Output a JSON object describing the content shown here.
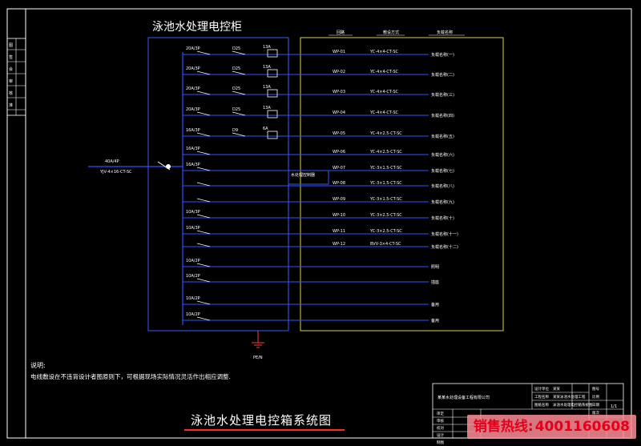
{
  "cabinet_title": "泳池水处理电控柜",
  "diagram_title": "泳池水处理电控箱系统图",
  "notes": {
    "heading": "说明:",
    "body": "电线敷设在不违背设计者图原则下，可根据现场实际情况灵活作出相应调整."
  },
  "hotline": {
    "label": "销售热线:",
    "number": "4001160608"
  },
  "incoming": {
    "breaker": "40A/4P",
    "cable": "YJV-4×16-CT-SC"
  },
  "header": {
    "col1": "回路",
    "col2": "敷设方式",
    "col3": "负载名称"
  },
  "ground_label": "PE/N",
  "circuits": [
    {
      "breaker": "20A/3P",
      "contactor": "D25",
      "relay": "13A",
      "id": "WP-01",
      "cable": "YC-4×4-CT-SC",
      "load": "负载名称(一)"
    },
    {
      "breaker": "20A/3P",
      "contactor": "D25",
      "relay": "13A",
      "id": "WP-02",
      "cable": "YC-4×4-CT-SC",
      "load": "负载名称(二)"
    },
    {
      "breaker": "20A/3P",
      "contactor": "D25",
      "relay": "13A",
      "id": "WP-03",
      "cable": "YC-4×4-CT-SC",
      "load": "负载名称(三)"
    },
    {
      "breaker": "20A/3P",
      "contactor": "D25",
      "relay": "13A",
      "id": "WP-04",
      "cable": "YC-4×4-CT-SC",
      "load": "负载名称(四)"
    },
    {
      "breaker": "16A/3P",
      "contactor": "D9",
      "relay": "6A",
      "id": "WP-05",
      "cable": "YC-4×2.5-CT-SC",
      "load": "负载名称(五)"
    },
    {
      "breaker": "16A/3P",
      "contactor": "",
      "relay": "",
      "id": "WP-06",
      "cable": "YC-4×2.5-CT-SC",
      "load": "负载名称(六)"
    },
    {
      "breaker": "16A/3P",
      "contactor": "",
      "relay": "",
      "id": "WP-07",
      "cable": "YC-3×1.5-CT-SC",
      "load": "负载名称(七)"
    },
    {
      "breaker": "",
      "contactor": "",
      "relay": "",
      "id": "WP-08",
      "cable": "YC-3×1.5-CT-SC",
      "load": "负载名称(八)"
    },
    {
      "breaker": "",
      "contactor": "",
      "relay": "",
      "id": "WP-09",
      "cable": "YC-3×1.5-CT-SC",
      "load": "负载名称(九)"
    },
    {
      "breaker": "10A/3P",
      "contactor": "",
      "relay": "",
      "id": "WP-10",
      "cable": "YC-3×2.5-CT-SC",
      "load": "负载名称(十)"
    },
    {
      "breaker": "10A/3P",
      "contactor": "",
      "relay": "",
      "id": "WP-11",
      "cable": "YC-3×2.5-CT-SC",
      "load": "负载名称(十一)"
    },
    {
      "breaker": "",
      "contactor": "",
      "relay": "",
      "id": "WP-12",
      "cable": "BVV-3×4-CT-SC",
      "load": "负载名称(十二)"
    },
    {
      "breaker": "10A/2P",
      "contactor": "",
      "relay": "",
      "id": "",
      "cable": "",
      "load": "照明"
    },
    {
      "breaker": "10A/2P",
      "contactor": "",
      "relay": "",
      "id": "",
      "cable": "",
      "load": "插座"
    },
    {
      "breaker": "10A/2P",
      "contactor": "",
      "relay": "",
      "id": "",
      "cable": "",
      "load": "备用"
    },
    {
      "breaker": "10A/2P",
      "contactor": "",
      "relay": "",
      "id": "",
      "cable": "",
      "load": "备用"
    }
  ],
  "controller_label": "水处理控制器",
  "title_block": {
    "company": "某某水处理设备工程有限公司",
    "rows": [
      [
        "设计单位",
        "某某"
      ],
      [
        "工程名称",
        "某某泳池水处理工程"
      ],
      [
        "图纸名称",
        "泳池水处理电控箱系统图"
      ]
    ],
    "left_rows": [
      "审定",
      "审核",
      "校对",
      "设计",
      "制图"
    ],
    "right": [
      "图号",
      "比例",
      "日期",
      "版次"
    ],
    "sheet_no": "1/1"
  },
  "side_column": [
    "图",
    "签",
    "会",
    "审",
    "核",
    "准"
  ],
  "colors": {
    "frame": "#ffffff",
    "line_blue": "#2f52ff",
    "cabinet_box": "#3a5bff",
    "terminal_box": "#d9d04a",
    "ground": "#ff3a3a"
  }
}
